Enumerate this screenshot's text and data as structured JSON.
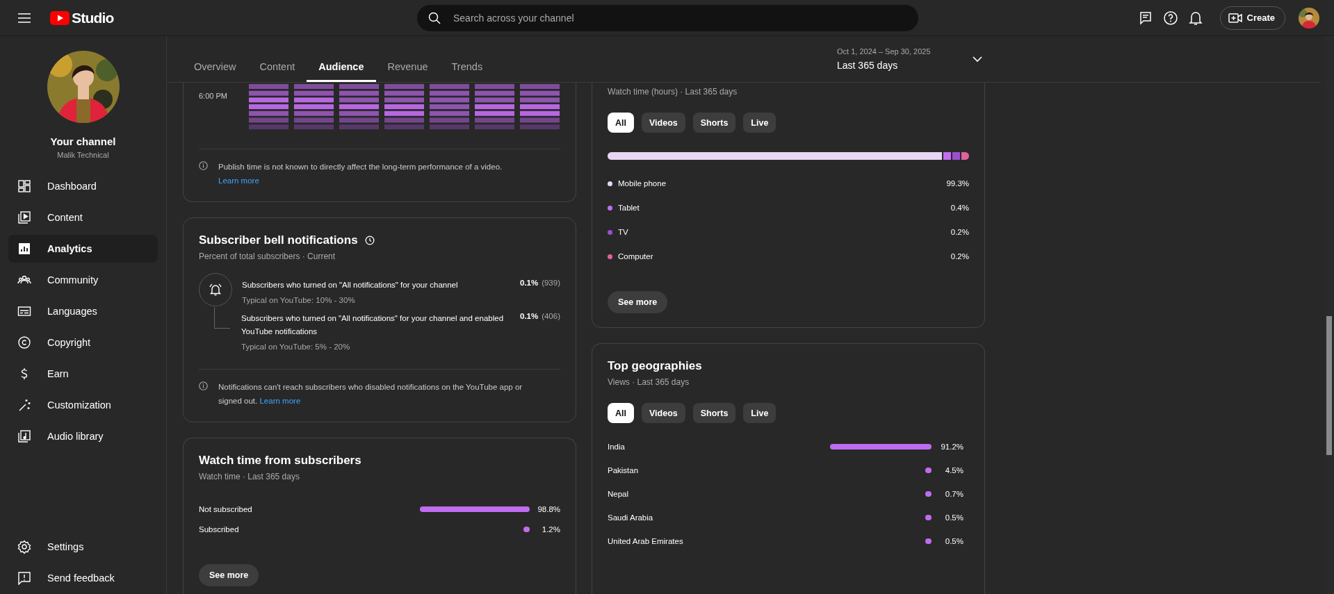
{
  "topbar": {
    "logo": "Studio",
    "search": {
      "placeholder": "Search across your channel"
    },
    "create_button": "Create"
  },
  "sidebar": {
    "channel_title": "Your channel",
    "channel_name": "Malik Technical",
    "items": [
      {
        "label": "Dashboard",
        "selected": false
      },
      {
        "label": "Content",
        "selected": false
      },
      {
        "label": "Analytics",
        "selected": true
      },
      {
        "label": "Community",
        "selected": false
      },
      {
        "label": "Languages",
        "selected": false
      },
      {
        "label": "Copyright",
        "selected": false
      },
      {
        "label": "Earn",
        "selected": false
      },
      {
        "label": "Customization",
        "selected": false
      },
      {
        "label": "Audio library",
        "selected": false
      }
    ],
    "footer_items": [
      {
        "label": "Settings"
      },
      {
        "label": "Send feedback"
      }
    ]
  },
  "tabs": [
    {
      "label": "Overview",
      "selected": false
    },
    {
      "label": "Content",
      "selected": false
    },
    {
      "label": "Audience",
      "selected": true
    },
    {
      "label": "Revenue",
      "selected": false
    },
    {
      "label": "Trends",
      "selected": false
    }
  ],
  "date_range": {
    "dates": "Oct 1, 2024 – Sep 30, 2025",
    "label": "Last 365 days"
  },
  "publish_time": {
    "row_label": "6:00 PM",
    "note": {
      "text": "Publish time is not known to directly affect the long-term performance of a video.",
      "link": "Learn more"
    }
  },
  "bell_notifications": {
    "title": "Subscriber bell notifications",
    "subtitle": "Percent of total subscribers · Current",
    "rows": [
      {
        "text": "Subscribers who turned on \"All notifications\" for your channel",
        "typical": "Typical on YouTube: 10% - 30%",
        "percent": "0.1%",
        "count": "(939)",
        "children": [
          {
            "text": "Subscribers who turned on \"All notifications\" for your channel and enabled YouTube notifications",
            "typical": "Typical on YouTube: 5% - 20%",
            "percent": "0.1%",
            "count": "(406)"
          }
        ]
      }
    ],
    "note": {
      "text": "Notifications can't reach subscribers who disabled notifications on the YouTube app or signed out.",
      "link": "Learn more"
    }
  },
  "watch_time_subscribers": {
    "title": "Watch time from subscribers",
    "subtitle": "Watch time · Last 365 days",
    "rows": [
      {
        "label": "Not subscribed",
        "percent": "98.8%"
      },
      {
        "label": "Subscribed",
        "percent": "1.2%"
      }
    ],
    "button": "See more"
  },
  "device_type": {
    "subtitle": "Watch time (hours) · Last 365 days",
    "chips": [
      {
        "label": "All",
        "selected": true
      },
      {
        "label": "Videos",
        "selected": false
      },
      {
        "label": "Shorts",
        "selected": false
      },
      {
        "label": "Live",
        "selected": false
      }
    ],
    "devices": [
      {
        "label": "Mobile phone",
        "percent": "99.3%",
        "color": "#e8d7f3"
      },
      {
        "label": "Tablet",
        "percent": "0.4%",
        "color": "#c36ef0"
      },
      {
        "label": "TV",
        "percent": "0.2%",
        "color": "#9c4fd0"
      },
      {
        "label": "Computer",
        "percent": "0.2%",
        "color": "#e0629f"
      }
    ],
    "button": "See more"
  },
  "top_geographies": {
    "title": "Top geographies",
    "subtitle": "Views · Last 365 days",
    "chips": [
      {
        "label": "All",
        "selected": true
      },
      {
        "label": "Videos",
        "selected": false
      },
      {
        "label": "Shorts",
        "selected": false
      },
      {
        "label": "Live",
        "selected": false
      }
    ],
    "rows": [
      {
        "label": "India",
        "percent": "91.2%"
      },
      {
        "label": "Pakistan",
        "percent": "4.5%"
      },
      {
        "label": "Nepal",
        "percent": "0.7%"
      },
      {
        "label": "Saudi Arabia",
        "percent": "0.5%"
      },
      {
        "label": "United Arab Emirates",
        "percent": "0.5%"
      }
    ]
  }
}
